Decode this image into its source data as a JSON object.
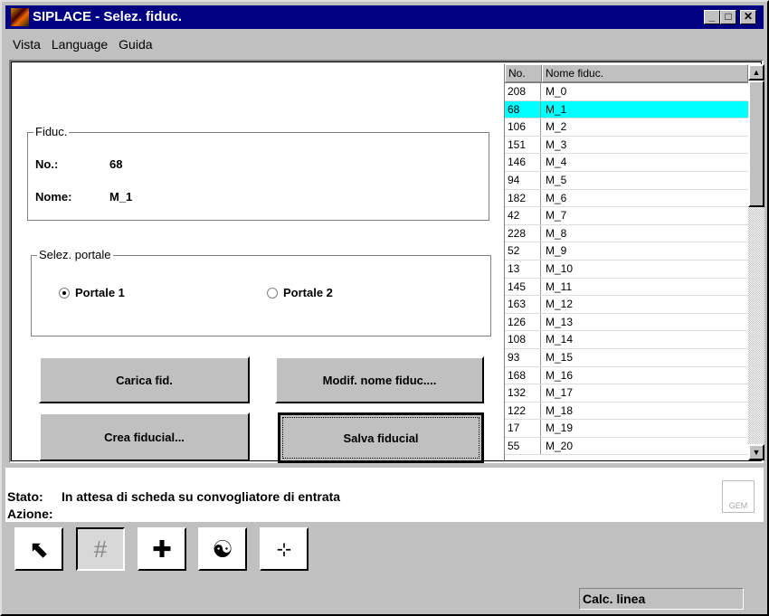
{
  "window": {
    "title": "SIPLACE - Selez. fiduc.",
    "min": "_",
    "max": "□",
    "close": "✕"
  },
  "menu": [
    {
      "label": "Vista"
    },
    {
      "label": "Language"
    },
    {
      "label": "Guida"
    }
  ],
  "fiduc": {
    "group_label": "Fiduc.",
    "no_label": "No.:",
    "no_value": "68",
    "name_label": "Nome:",
    "name_value": "M_1"
  },
  "portal": {
    "group_label": "Selez. portale",
    "options": [
      {
        "label": "Portale 1",
        "selected": true
      },
      {
        "label": "Portale 2",
        "selected": false
      }
    ]
  },
  "buttons": {
    "load": "Carica fid.",
    "rename": "Modif. nome fiduc....",
    "create": "Crea fiducial...",
    "save": "Salva fiducial"
  },
  "list": {
    "headers": [
      "No.",
      "Nome fiduc."
    ],
    "selected_index": 1,
    "rows": [
      [
        "208",
        "M_0"
      ],
      [
        "68",
        "M_1"
      ],
      [
        "106",
        "M_2"
      ],
      [
        "151",
        "M_3"
      ],
      [
        "146",
        "M_4"
      ],
      [
        "94",
        "M_5"
      ],
      [
        "182",
        "M_6"
      ],
      [
        "42",
        "M_7"
      ],
      [
        "228",
        "M_8"
      ],
      [
        "52",
        "M_9"
      ],
      [
        "13",
        "M_10"
      ],
      [
        "145",
        "M_11"
      ],
      [
        "163",
        "M_12"
      ],
      [
        "126",
        "M_13"
      ],
      [
        "108",
        "M_14"
      ],
      [
        "93",
        "M_15"
      ],
      [
        "168",
        "M_16"
      ],
      [
        "132",
        "M_17"
      ],
      [
        "122",
        "M_18"
      ],
      [
        "17",
        "M_19"
      ],
      [
        "55",
        "M_20"
      ]
    ]
  },
  "status": {
    "state_label": "Stato:",
    "state_value": "In attesa di scheda su convogliatore di entrata",
    "action_label": "Azione:",
    "mail_icon_text": "GEM"
  },
  "statusbar": {
    "text": "Calc. linea"
  },
  "colors": {
    "titlebar": "#000080",
    "selection": "#00ffff"
  }
}
